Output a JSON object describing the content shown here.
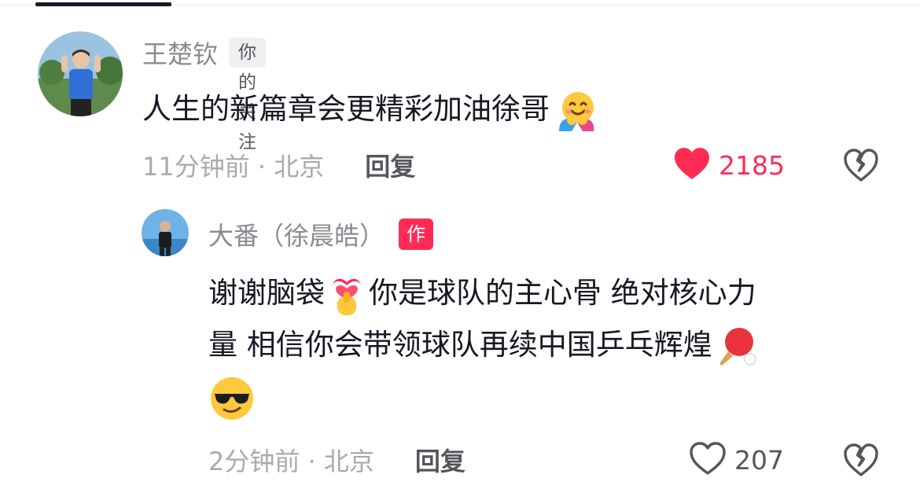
{
  "comments": [
    {
      "username": "王楚钦",
      "badge": "你的关注",
      "text": "人生的新篇章会更精彩加油徐哥",
      "emoji": "hugging-face-icon",
      "time_location": "11分钟前 · 北京",
      "reply_label": "回复",
      "likes": "2185",
      "liked": true,
      "like_color": "#fe2c55"
    },
    {
      "username": "大番（徐晨皓）",
      "badge": "作者",
      "text_line1": "谢谢脑袋",
      "text_line1b": "你是球队的主心骨 绝对核心力",
      "text_line2": "量 相信你会带领球队再续中国乒乓辉煌",
      "emojis": [
        "finger-heart-icon",
        "ping-pong-icon",
        "sunglasses-face-icon"
      ],
      "time_location": "2分钟前 · 北京",
      "reply_label": "回复",
      "likes": "207",
      "liked": false,
      "badge_color": "#fe2c55"
    }
  ]
}
